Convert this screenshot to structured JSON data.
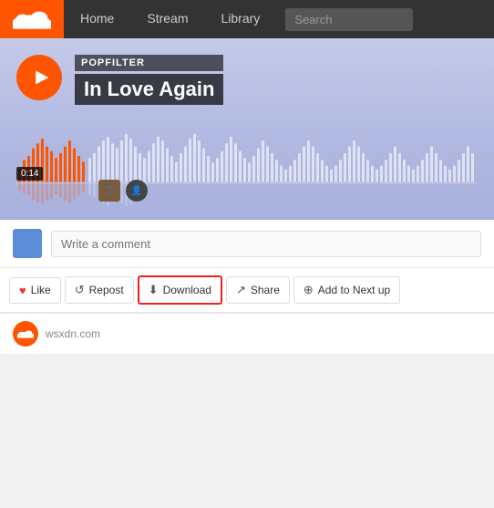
{
  "navbar": {
    "logo_alt": "SoundCloud",
    "links": [
      {
        "label": "Home",
        "active": false
      },
      {
        "label": "Stream",
        "active": false
      },
      {
        "label": "Library",
        "active": false
      }
    ],
    "search_placeholder": "Search"
  },
  "player": {
    "artist": "POPFILTER",
    "title": "In Love Again",
    "play_label": "Play",
    "time": "0:14"
  },
  "comment": {
    "placeholder": "Write a comment"
  },
  "actions": [
    {
      "id": "like",
      "icon": "♥",
      "label": "Like"
    },
    {
      "id": "repost",
      "icon": "↺",
      "label": "Repost"
    },
    {
      "id": "download",
      "icon": "⬇",
      "label": "Download"
    },
    {
      "id": "share",
      "icon": "↗",
      "label": "Share"
    },
    {
      "id": "next",
      "icon": "⊕",
      "label": "Add to Next up"
    }
  ],
  "footer": {
    "text": "wsxdn.com"
  },
  "waveform": {
    "played_color": "#ff5500",
    "unplayed_color": "rgba(255,255,255,0.55)",
    "reflect_played_color": "rgba(255,85,0,0.25)",
    "reflect_unplayed_color": "rgba(255,255,255,0.2)"
  }
}
